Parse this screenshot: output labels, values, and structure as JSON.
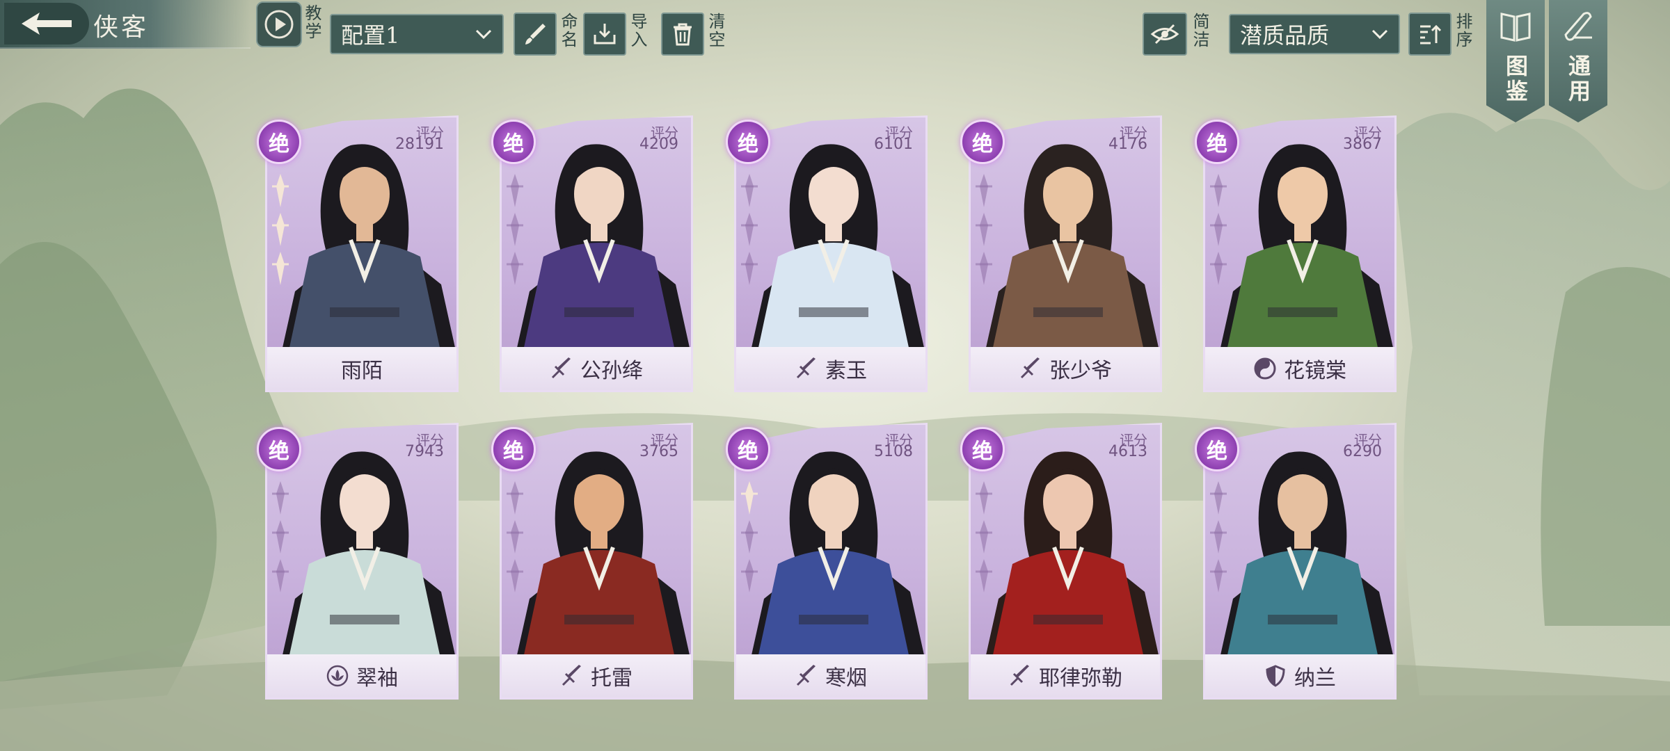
{
  "header": {
    "title": "侠客",
    "tutorial_label": "教学",
    "config_select": {
      "value": "配置1"
    },
    "rename_label": "命名",
    "import_label": "导入",
    "clear_label": "清空",
    "simple_label": "简洁",
    "sort_select": {
      "value": "潜质品质"
    },
    "sort_label": "排序",
    "codex_label": "图鉴",
    "general_label": "通用"
  },
  "score_label": "评分",
  "rank_label": "绝",
  "heroes": [
    {
      "name": "雨陌",
      "score": "28191",
      "faction_icon": "none",
      "stars": 3,
      "robe": "#44506a",
      "skin": "#e2b896",
      "hair": "#1c1a1f"
    },
    {
      "name": "公孙绛",
      "score": "4209",
      "faction_icon": "sword-icon",
      "stars": 0,
      "robe": "#4c3a80",
      "skin": "#f0d6c4",
      "hair": "#1c1a1f"
    },
    {
      "name": "素玉",
      "score": "6101",
      "faction_icon": "sword-icon",
      "stars": 0,
      "robe": "#d9e6f2",
      "skin": "#f3ddd0",
      "hair": "#1c1a1f"
    },
    {
      "name": "张少爷",
      "score": "4176",
      "faction_icon": "sword-icon",
      "stars": 0,
      "robe": "#7b5a46",
      "skin": "#e9c4a2",
      "hair": "#2a2220"
    },
    {
      "name": "花镜棠",
      "score": "3867",
      "faction_icon": "yinyang-icon",
      "stars": 0,
      "robe": "#4f7a3c",
      "skin": "#eec9a8",
      "hair": "#1c1a1f"
    },
    {
      "name": "翠袖",
      "score": "7943",
      "faction_icon": "lotus-icon",
      "stars": 0,
      "robe": "#c9dcd8",
      "skin": "#f3ddd0",
      "hair": "#1c1a1f"
    },
    {
      "name": "托雷",
      "score": "3765",
      "faction_icon": "sword-icon",
      "stars": 0,
      "robe": "#8a2a22",
      "skin": "#e2ad84",
      "hair": "#1c1a1f"
    },
    {
      "name": "寒烟",
      "score": "5108",
      "faction_icon": "sword-icon",
      "stars": 1,
      "robe": "#3d4f9a",
      "skin": "#f0d3bf",
      "hair": "#1c1a1f"
    },
    {
      "name": "耶律弥勒",
      "score": "4613",
      "faction_icon": "sword-icon",
      "stars": 0,
      "robe": "#a3201e",
      "skin": "#edc7b0",
      "hair": "#2b1d1a"
    },
    {
      "name": "纳兰",
      "score": "6290",
      "faction_icon": "shield-icon",
      "stars": 0,
      "robe": "#3f7f8f",
      "skin": "#e6c0a0",
      "hair": "#1c1a1f"
    }
  ]
}
